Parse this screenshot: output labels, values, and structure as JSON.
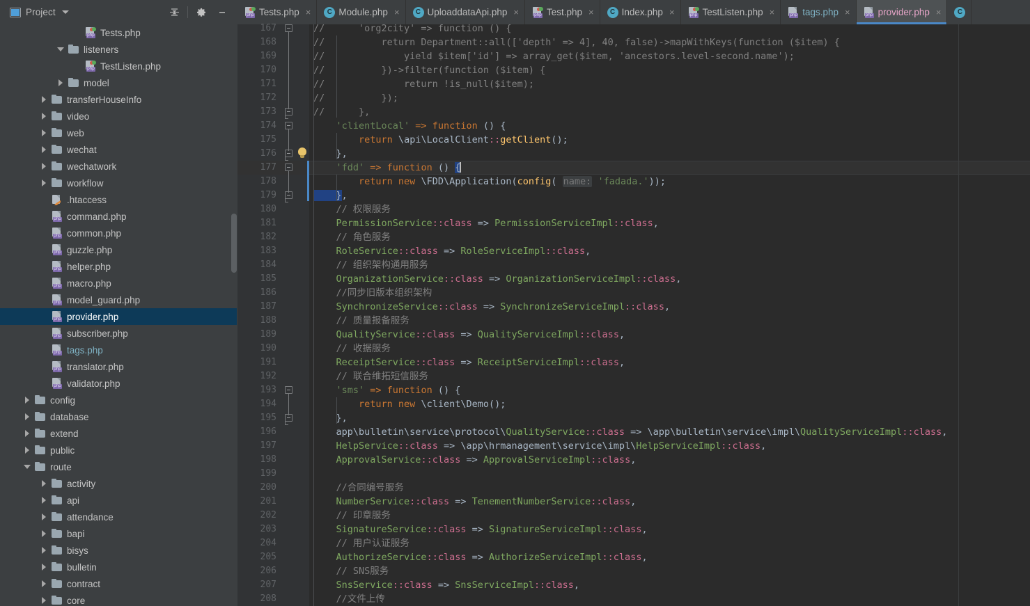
{
  "window": {
    "toolbar": {
      "project_label": "Project",
      "project_icon": "project-panel-icon",
      "dropdown_icon": "chevron-down-icon",
      "collapse_all_icon": "collapse-all-icon",
      "settings_icon": "gear-icon",
      "hide_icon": "minimize-icon"
    }
  },
  "tabs": [
    {
      "label": "Tests.php",
      "icon": "php-test-file-icon",
      "active": false,
      "close": "×"
    },
    {
      "label": "Module.php",
      "icon": "php-class-icon",
      "active": false,
      "close": "×"
    },
    {
      "label": "UploaddataApi.php",
      "icon": "php-class-icon",
      "active": false,
      "close": "×"
    },
    {
      "label": "Test.php",
      "icon": "php-test-file-icon",
      "active": false,
      "close": "×"
    },
    {
      "label": "Index.php",
      "icon": "php-class-icon",
      "active": false,
      "close": "×"
    },
    {
      "label": "TestListen.php",
      "icon": "php-test-file-icon",
      "active": false,
      "close": "×"
    },
    {
      "label": "tags.php",
      "icon": "php-file-icon",
      "active": false,
      "close": "×",
      "muted": true
    },
    {
      "label": "provider.php",
      "icon": "php-file-icon",
      "active": true,
      "close": "×"
    }
  ],
  "tree": [
    {
      "label": "Tests.php",
      "indent": 4,
      "arrow": "none",
      "icon": "php-test-file-icon"
    },
    {
      "label": "listeners",
      "indent": 3,
      "arrow": "expanded",
      "icon": "folder-icon"
    },
    {
      "label": "TestListen.php",
      "indent": 4,
      "arrow": "none",
      "icon": "php-test-file-icon"
    },
    {
      "label": "model",
      "indent": 3,
      "arrow": "collapsed",
      "icon": "folder-icon"
    },
    {
      "label": "transferHouseInfo",
      "indent": 2,
      "arrow": "collapsed",
      "icon": "folder-icon"
    },
    {
      "label": "video",
      "indent": 2,
      "arrow": "collapsed",
      "icon": "folder-icon"
    },
    {
      "label": "web",
      "indent": 2,
      "arrow": "collapsed",
      "icon": "folder-icon"
    },
    {
      "label": "wechat",
      "indent": 2,
      "arrow": "collapsed",
      "icon": "folder-icon"
    },
    {
      "label": "wechatwork",
      "indent": 2,
      "arrow": "collapsed",
      "icon": "folder-icon"
    },
    {
      "label": "workflow",
      "indent": 2,
      "arrow": "collapsed",
      "icon": "folder-icon"
    },
    {
      "label": ".htaccess",
      "indent": 2,
      "arrow": "none",
      "icon": "htaccess-file-icon"
    },
    {
      "label": "command.php",
      "indent": 2,
      "arrow": "none",
      "icon": "php-file-icon"
    },
    {
      "label": "common.php",
      "indent": 2,
      "arrow": "none",
      "icon": "php-file-icon"
    },
    {
      "label": "guzzle.php",
      "indent": 2,
      "arrow": "none",
      "icon": "php-file-icon"
    },
    {
      "label": "helper.php",
      "indent": 2,
      "arrow": "none",
      "icon": "php-file-icon"
    },
    {
      "label": "macro.php",
      "indent": 2,
      "arrow": "none",
      "icon": "php-file-icon"
    },
    {
      "label": "model_guard.php",
      "indent": 2,
      "arrow": "none",
      "icon": "php-file-icon"
    },
    {
      "label": "provider.php",
      "indent": 2,
      "arrow": "none",
      "icon": "php-file-icon",
      "selected": true
    },
    {
      "label": "subscriber.php",
      "indent": 2,
      "arrow": "none",
      "icon": "php-file-icon"
    },
    {
      "label": "tags.php",
      "indent": 2,
      "arrow": "none",
      "icon": "php-file-icon",
      "muted": true
    },
    {
      "label": "translator.php",
      "indent": 2,
      "arrow": "none",
      "icon": "php-file-icon"
    },
    {
      "label": "validator.php",
      "indent": 2,
      "arrow": "none",
      "icon": "php-file-icon"
    },
    {
      "label": "config",
      "indent": 1,
      "arrow": "collapsed",
      "icon": "folder-icon"
    },
    {
      "label": "database",
      "indent": 1,
      "arrow": "collapsed",
      "icon": "folder-icon"
    },
    {
      "label": "extend",
      "indent": 1,
      "arrow": "collapsed",
      "icon": "folder-icon"
    },
    {
      "label": "public",
      "indent": 1,
      "arrow": "collapsed",
      "icon": "folder-icon"
    },
    {
      "label": "route",
      "indent": 1,
      "arrow": "expanded",
      "icon": "folder-icon"
    },
    {
      "label": "activity",
      "indent": 2,
      "arrow": "collapsed",
      "icon": "folder-icon"
    },
    {
      "label": "api",
      "indent": 2,
      "arrow": "collapsed",
      "icon": "folder-icon"
    },
    {
      "label": "attendance",
      "indent": 2,
      "arrow": "collapsed",
      "icon": "folder-icon"
    },
    {
      "label": "bapi",
      "indent": 2,
      "arrow": "collapsed",
      "icon": "folder-icon"
    },
    {
      "label": "bisys",
      "indent": 2,
      "arrow": "collapsed",
      "icon": "folder-icon"
    },
    {
      "label": "bulletin",
      "indent": 2,
      "arrow": "collapsed",
      "icon": "folder-icon"
    },
    {
      "label": "contract",
      "indent": 2,
      "arrow": "collapsed",
      "icon": "folder-icon"
    },
    {
      "label": "core",
      "indent": 2,
      "arrow": "collapsed",
      "icon": "folder-icon"
    }
  ],
  "editor": {
    "first_line": 167,
    "caret_line": 177,
    "lines": [
      {
        "n": 167,
        "fold": "start-com",
        "html": "<span class='c-com'>//      'org2city' =&gt; function () {</span>"
      },
      {
        "n": 168,
        "html": "<span class='c-com'>//          return Department::all(['depth' =&gt; 4], 40, false)-&gt;mapWithKeys(function ($item) {</span>"
      },
      {
        "n": 169,
        "html": "<span class='c-com'>//              yield $item['id'] =&gt; array_get($item, 'ancestors.level-second.name');</span>"
      },
      {
        "n": 170,
        "html": "<span class='c-com'>//          })-&gt;filter(function ($item) {</span>"
      },
      {
        "n": 171,
        "html": "<span class='c-com'>//              return !is_null($item);</span>"
      },
      {
        "n": 172,
        "html": "<span class='c-com'>//          });</span>"
      },
      {
        "n": 173,
        "fold": "end-com",
        "html": "<span class='c-com'>//      },</span>"
      },
      {
        "n": 174,
        "fold": "start",
        "html": "<span class='c-str'>    'clientLocal'</span><span class='c-kw'> =&gt; </span><span class='c-kw'>function</span><span class='c-txt'> () {</span>"
      },
      {
        "n": 175,
        "html": "<span class='c-kw'>        return</span><span class='c-txt'> \\</span><span class='c-cls'>api</span><span class='c-txt'>\\</span><span class='c-cls'>LocalClient</span><span class='c-pink'>::</span><span class='c-fn'>getClient</span><span class='c-txt'>();</span>"
      },
      {
        "n": 176,
        "fold": "end",
        "bulb": true,
        "html": "<span class='c-txt'>    },</span>"
      },
      {
        "n": 177,
        "fold": "start",
        "caret": true,
        "html": "<span class='c-str'>    'fdd'</span><span class='c-kw'> =&gt; </span><span class='c-kw'>function</span><span class='c-txt'> () </span><span class='sel-brace'>{</span><span class='caret'></span>"
      },
      {
        "n": 178,
        "html": "<span class='c-kw'>        return new</span><span class='c-txt'> \\FDD\\Application(</span><span class='c-fn'>config</span><span class='c-txt'>( </span><span class='c-hint'>name:</span><span class='c-str'> 'fadada.'</span><span class='c-txt'>));</span>"
      },
      {
        "n": 179,
        "fold": "end",
        "html": "<span class='sel-brace'>    }</span><span class='c-txt'>,</span>"
      },
      {
        "n": 180,
        "html": "<span class='c-com'>    // 权限服务</span>"
      },
      {
        "n": 181,
        "html": "<span class='c-green'>    PermissionService</span><span class='c-pink'>::class</span><span class='c-txt'> =&gt; </span><span class='c-green'>PermissionServiceImpl</span><span class='c-pink'>::class</span><span class='c-txt'>,</span>"
      },
      {
        "n": 182,
        "html": "<span class='c-com'>    // 角色服务</span>"
      },
      {
        "n": 183,
        "html": "<span class='c-green'>    RoleService</span><span class='c-pink'>::class</span><span class='c-txt'> =&gt; </span><span class='c-green'>RoleServiceImpl</span><span class='c-pink'>::class</span><span class='c-txt'>,</span>"
      },
      {
        "n": 184,
        "html": "<span class='c-com'>    // 组织架构通用服务</span>"
      },
      {
        "n": 185,
        "html": "<span class='c-green'>    OrganizationService</span><span class='c-pink'>::class</span><span class='c-txt'> =&gt; </span><span class='c-green'>OrganizationServiceImpl</span><span class='c-pink'>::class</span><span class='c-txt'>,</span>"
      },
      {
        "n": 186,
        "html": "<span class='c-com'>    //同步旧版本组织架构</span>"
      },
      {
        "n": 187,
        "html": "<span class='c-green'>    SynchronizeService</span><span class='c-pink'>::class</span><span class='c-txt'> =&gt; </span><span class='c-green'>SynchronizeServiceImpl</span><span class='c-pink'>::class</span><span class='c-txt'>,</span>"
      },
      {
        "n": 188,
        "html": "<span class='c-com'>    // 质量报备服务</span>"
      },
      {
        "n": 189,
        "html": "<span class='c-green'>    QualityService</span><span class='c-pink'>::class</span><span class='c-txt'> =&gt; </span><span class='c-green'>QualityServiceImpl</span><span class='c-pink'>::class</span><span class='c-txt'>,</span>"
      },
      {
        "n": 190,
        "html": "<span class='c-com'>    // 收据服务</span>"
      },
      {
        "n": 191,
        "html": "<span class='c-green'>    ReceiptService</span><span class='c-pink'>::class</span><span class='c-txt'> =&gt; </span><span class='c-green'>ReceiptServiceImpl</span><span class='c-pink'>::class</span><span class='c-txt'>,</span>"
      },
      {
        "n": 192,
        "html": "<span class='c-com'>    // 联合维拓短信服务</span>"
      },
      {
        "n": 193,
        "fold": "start",
        "html": "<span class='c-str'>    'sms'</span><span class='c-kw'> =&gt; </span><span class='c-kw'>function</span><span class='c-txt'> () {</span>"
      },
      {
        "n": 194,
        "html": "<span class='c-kw'>        return new</span><span class='c-txt'> \\client\\Demo();</span>"
      },
      {
        "n": 195,
        "fold": "end",
        "html": "<span class='c-txt'>    },</span>"
      },
      {
        "n": 196,
        "html": "<span class='c-txt'>    app\\bulletin\\service\\protocol\\</span><span class='c-green'>QualityService</span><span class='c-pink'>::class</span><span class='c-txt'> =&gt; \\app\\bulletin\\service\\impl\\</span><span class='c-green'>QualityServiceImpl</span><span class='c-pink'>::class</span><span class='c-txt'>,</span>"
      },
      {
        "n": 197,
        "html": "<span class='c-green'>    HelpService</span><span class='c-pink'>::class</span><span class='c-txt'> =&gt; \\app\\hrmanagement\\service\\impl\\</span><span class='c-green'>HelpServiceImpl</span><span class='c-pink'>::class</span><span class='c-txt'>,</span>"
      },
      {
        "n": 198,
        "html": "<span class='c-green'>    ApprovalService</span><span class='c-pink'>::class</span><span class='c-txt'> =&gt; </span><span class='c-green'>ApprovalServiceImpl</span><span class='c-pink'>::class</span><span class='c-txt'>,</span>"
      },
      {
        "n": 199,
        "html": ""
      },
      {
        "n": 200,
        "html": "<span class='c-com'>    //合同编号服务</span>"
      },
      {
        "n": 201,
        "html": "<span class='c-green'>    NumberService</span><span class='c-pink'>::class</span><span class='c-txt'> =&gt; </span><span class='c-green'>TenementNumberService</span><span class='c-pink'>::class</span><span class='c-txt'>,</span>"
      },
      {
        "n": 202,
        "html": "<span class='c-com'>    // 印章服务</span>"
      },
      {
        "n": 203,
        "html": "<span class='c-green'>    SignatureService</span><span class='c-pink'>::class</span><span class='c-txt'> =&gt; </span><span class='c-green'>SignatureServiceImpl</span><span class='c-pink'>::class</span><span class='c-txt'>,</span>"
      },
      {
        "n": 204,
        "html": "<span class='c-com'>    // 用户认证服务</span>"
      },
      {
        "n": 205,
        "html": "<span class='c-green'>    AuthorizeService</span><span class='c-pink'>::class</span><span class='c-txt'> =&gt; </span><span class='c-green'>AuthorizeServiceImpl</span><span class='c-pink'>::class</span><span class='c-txt'>,</span>"
      },
      {
        "n": 206,
        "html": "<span class='c-com'>    // SNS服务</span>"
      },
      {
        "n": 207,
        "html": "<span class='c-green'>    SnsService</span><span class='c-pink'>::class</span><span class='c-txt'> =&gt; </span><span class='c-green'>SnsServiceImpl</span><span class='c-pink'>::class</span><span class='c-txt'>,</span>"
      },
      {
        "n": 208,
        "html": "<span class='c-com'>    //文件上传</span>"
      }
    ]
  }
}
